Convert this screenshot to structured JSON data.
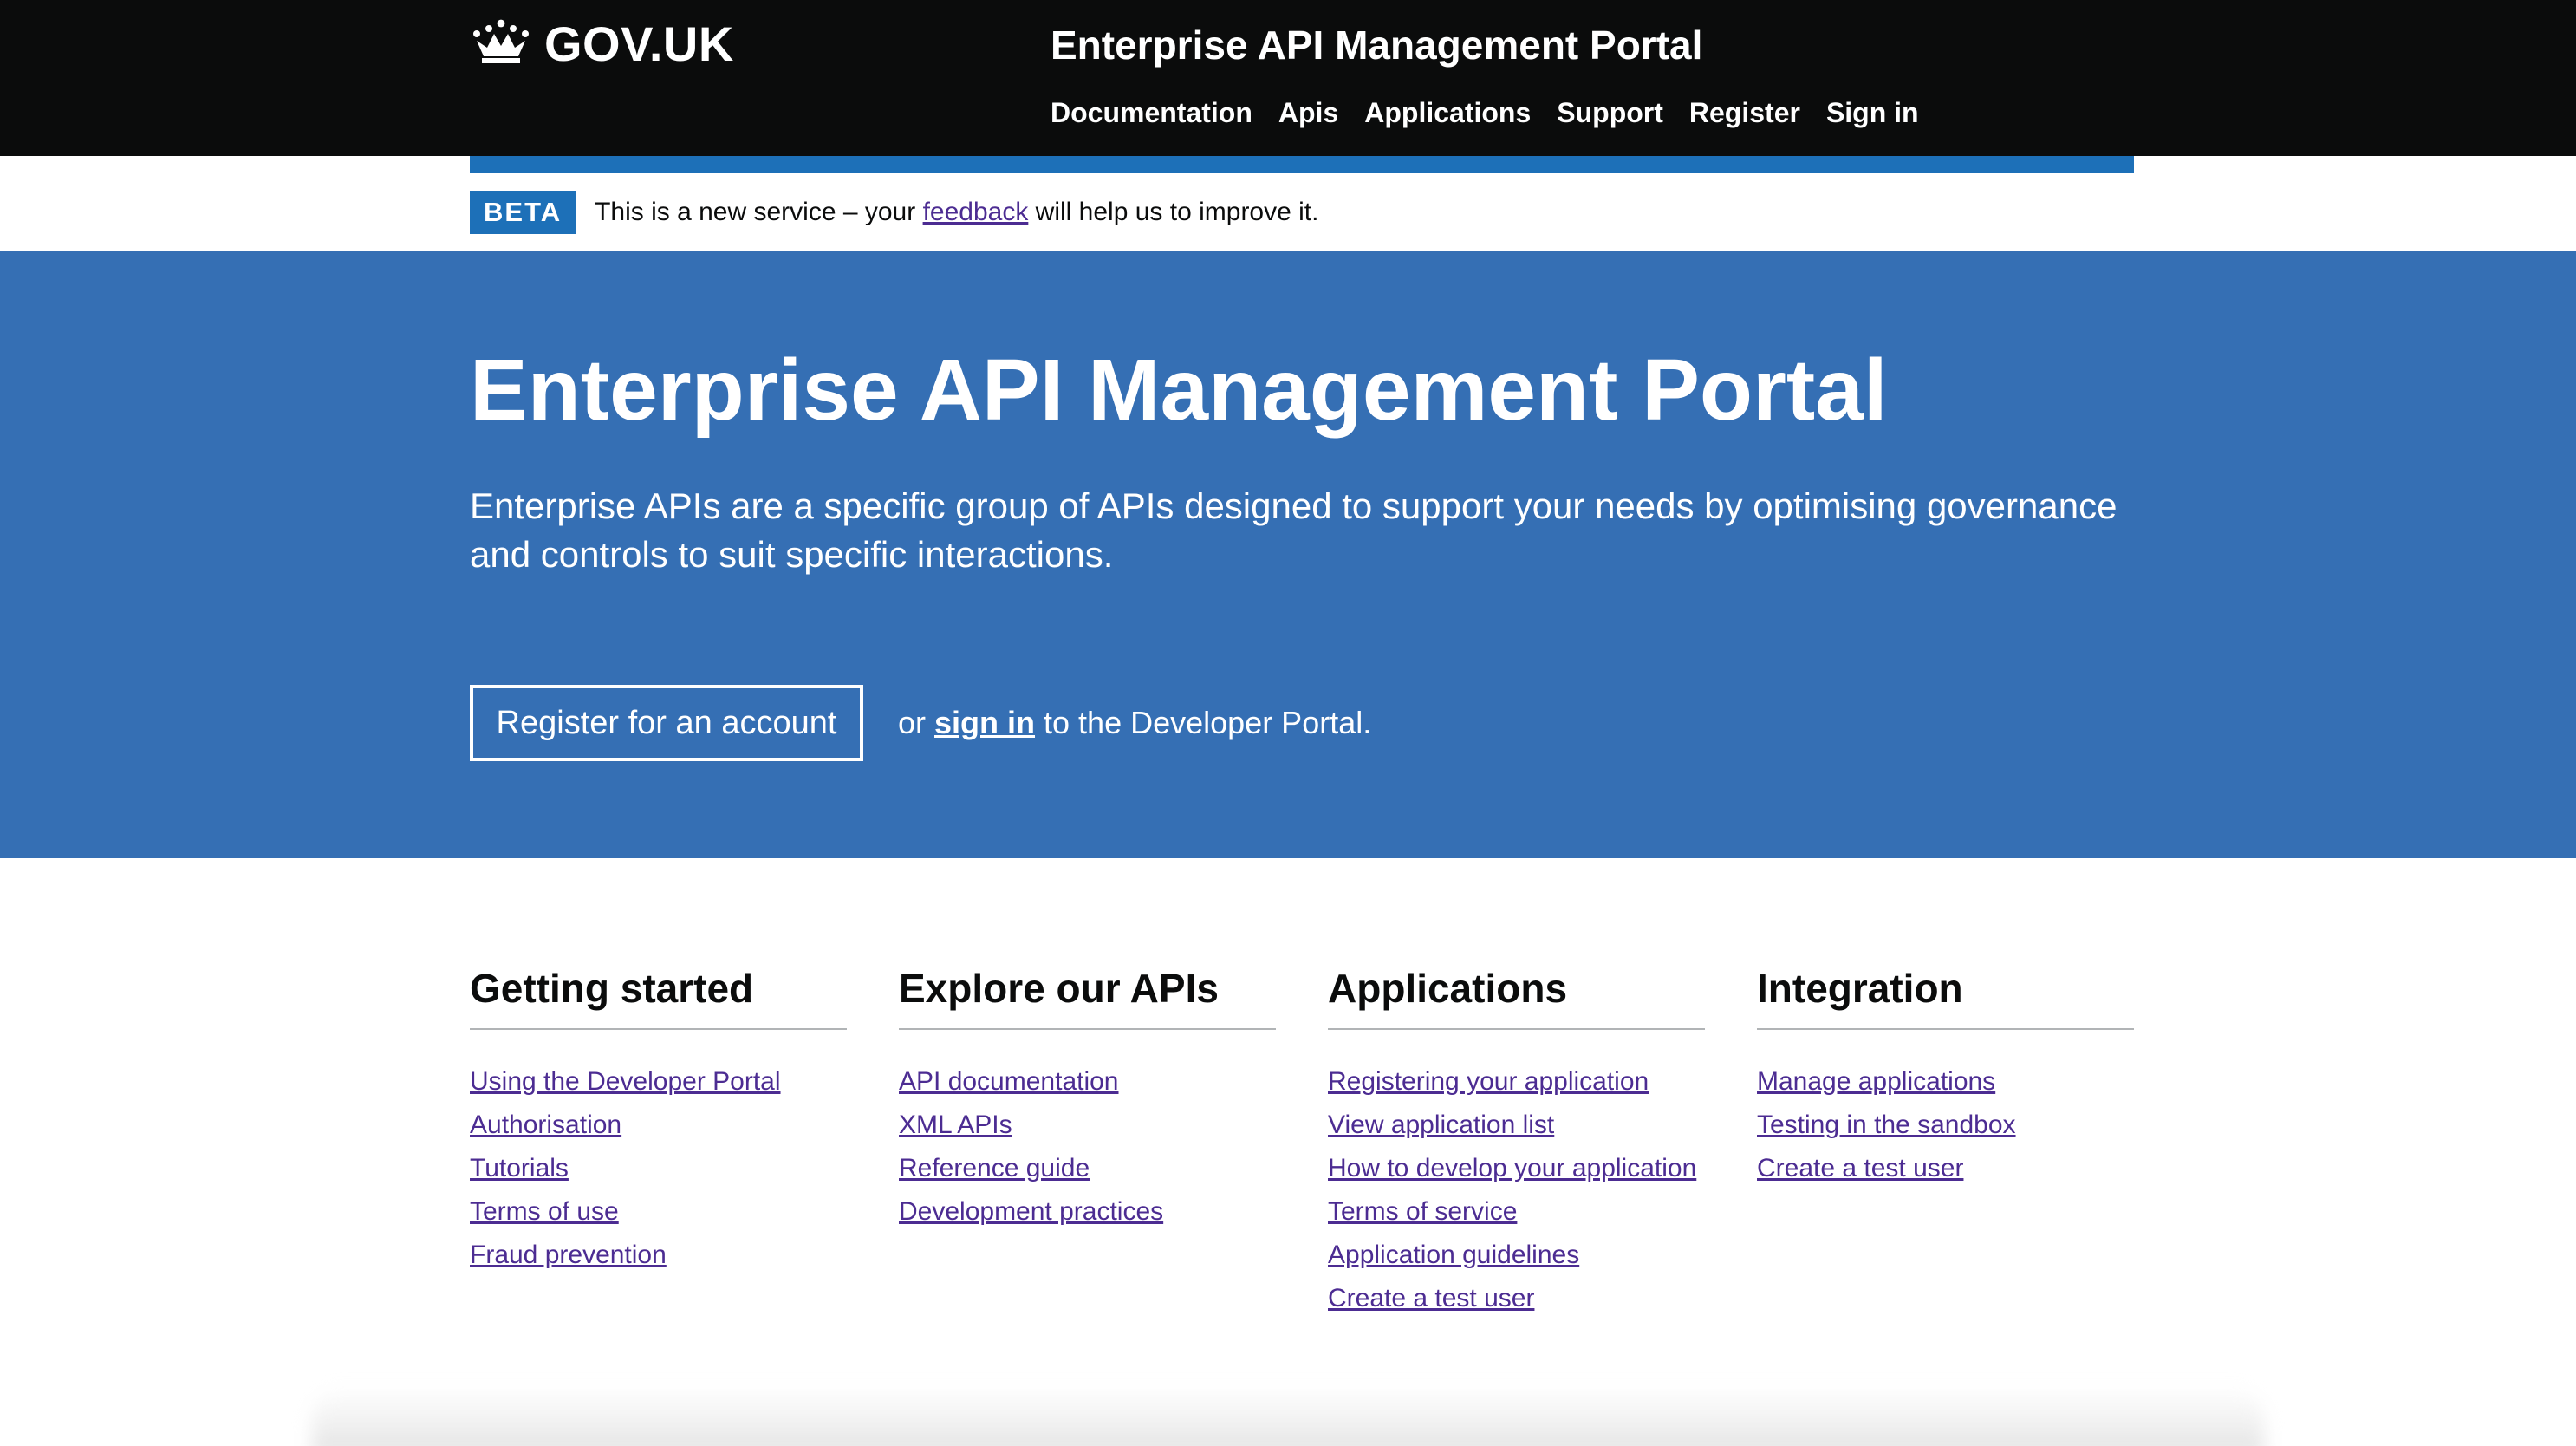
{
  "header": {
    "logo_text": "GOV.UK",
    "service_name": "Enterprise API Management Portal",
    "nav": [
      "Documentation",
      "Apis",
      "Applications",
      "Support",
      "Register",
      "Sign in"
    ]
  },
  "phase_banner": {
    "tag": "BETA",
    "text_before": "This is a new service – your ",
    "link": "feedback",
    "text_after": " will help us to improve it."
  },
  "hero": {
    "title": "Enterprise API Management Portal",
    "description": "Enterprise APIs are a specific group of APIs designed to support your needs by optimising governance and controls to suit specific interactions.",
    "register_button": "Register for an account",
    "or_text": "or ",
    "sign_in_link": "sign in",
    "after_text": " to the Developer Portal."
  },
  "columns": [
    {
      "heading": "Getting started",
      "links": [
        "Using the Developer Portal",
        "Authorisation",
        "Tutorials",
        "Terms of use",
        "Fraud prevention"
      ]
    },
    {
      "heading": "Explore our APIs",
      "links": [
        "API documentation",
        "XML APIs",
        "Reference guide",
        "Development practices"
      ]
    },
    {
      "heading": "Applications",
      "links": [
        "Registering your application",
        "View application list",
        "How to develop your application",
        "Terms of service",
        "Application guidelines",
        "Create a test user"
      ]
    },
    {
      "heading": "Integration",
      "links": [
        "Manage applications",
        "Testing in the sandbox",
        "Create a test user"
      ]
    }
  ],
  "colors": {
    "header_bg": "#0b0c0c",
    "brand_blue": "#1d70b8",
    "hero_bg": "#356fb4",
    "link": "#4c2c92"
  }
}
